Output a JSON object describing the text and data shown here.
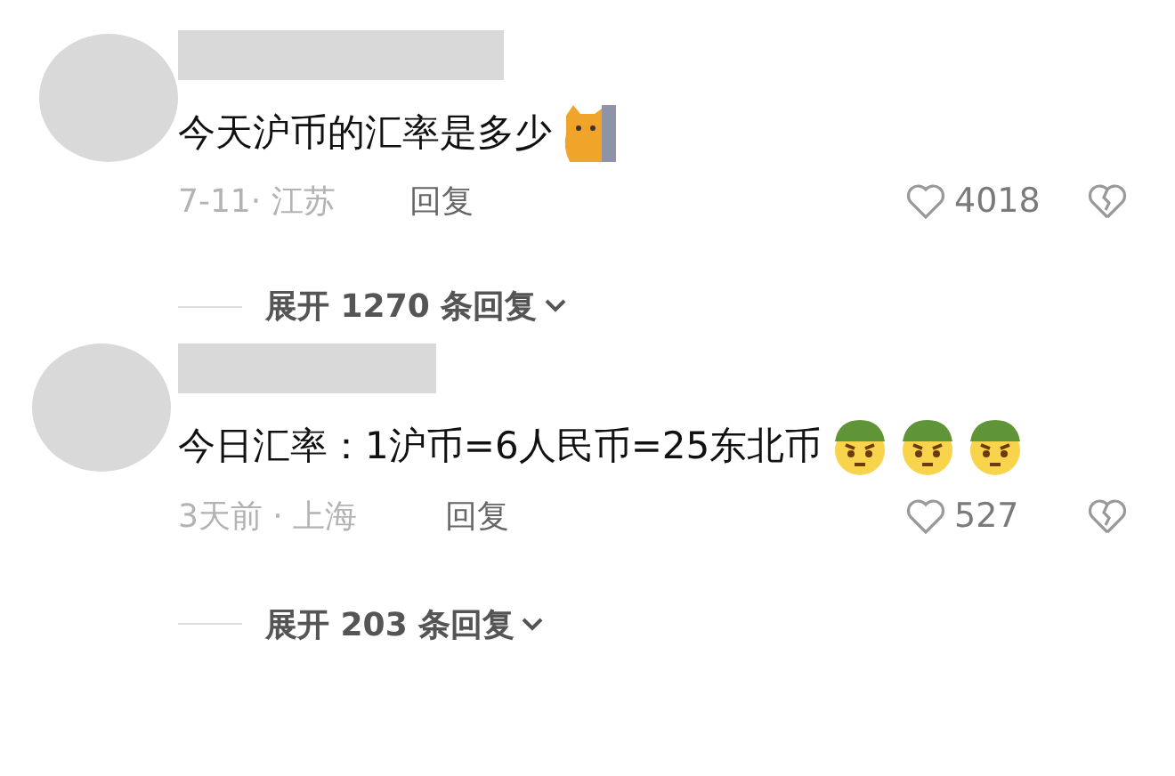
{
  "comments": [
    {
      "text": "今天沪币的汇率是多少",
      "stickers": [
        {
          "kind": "cat"
        }
      ],
      "meta": "7-11· 江苏",
      "reply": "回复",
      "likes": "4018",
      "expand": "展开 1270 条回复"
    },
    {
      "text": "今日汇率：1沪币=6人民币=25东北币",
      "stickers": [
        {
          "kind": "hat"
        },
        {
          "kind": "hat"
        },
        {
          "kind": "hat"
        }
      ],
      "meta": "3天前 · 上海",
      "reply": "回复",
      "likes": "527",
      "expand": "展开 203 条回复"
    }
  ]
}
